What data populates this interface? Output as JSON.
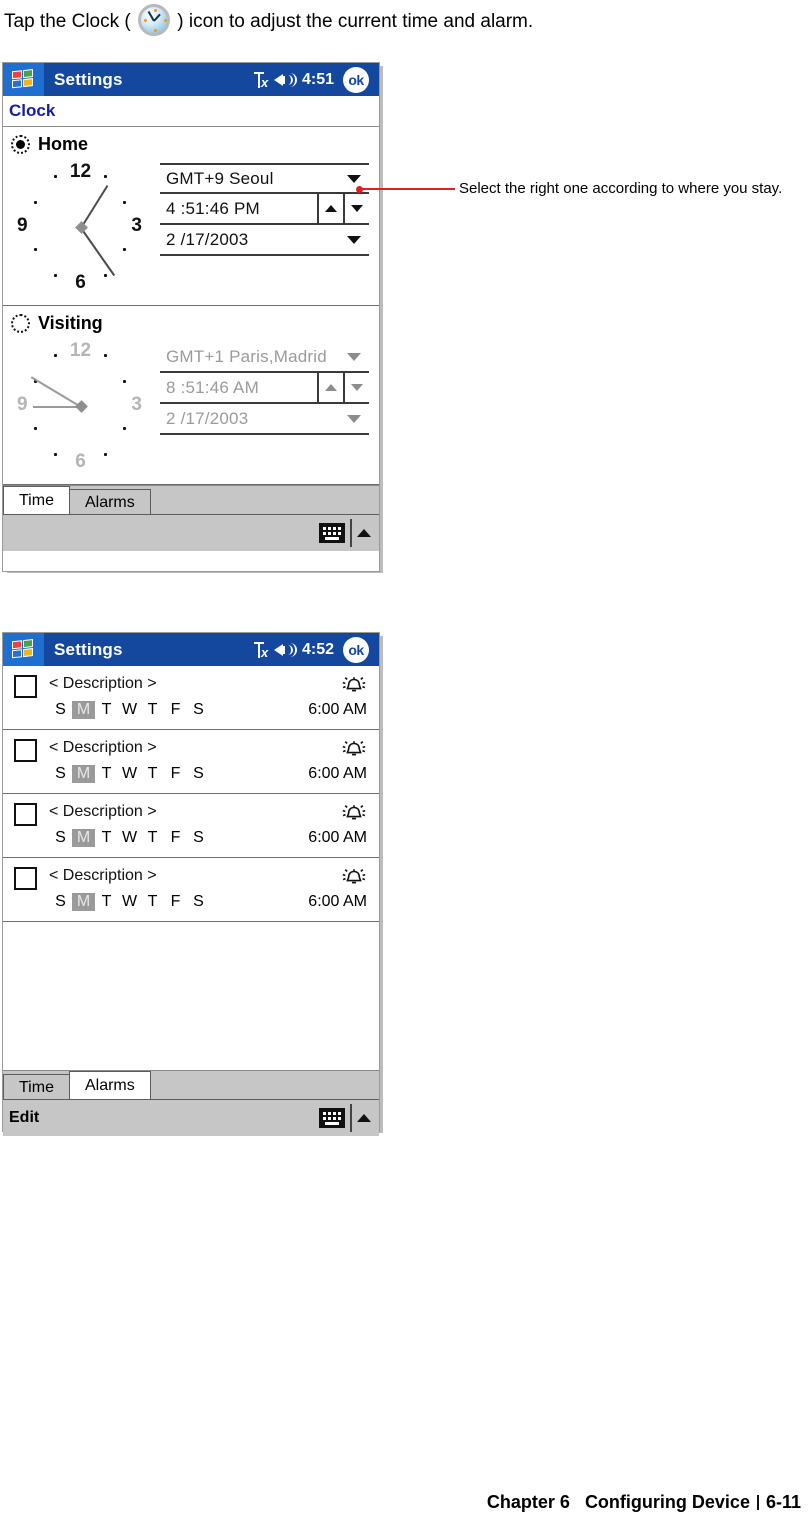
{
  "intro": {
    "before": "Tap the Clock ( ",
    "after": " ) icon to adjust the current time and alarm.",
    "icon": "clock-icon"
  },
  "screen1": {
    "titlebar": {
      "app": "Settings",
      "signal_icon": "signal-off-icon",
      "volume_icon": "volume-icon",
      "clock": "4:51",
      "ok": "ok"
    },
    "page_title": "Clock",
    "home": {
      "label": "Home",
      "selected": true,
      "timezone": "GMT+9 Seoul",
      "time": "4 :51:46 PM",
      "date": "2 /17/2003",
      "clock_numerals": [
        "12",
        "3",
        "6",
        "9"
      ]
    },
    "visiting": {
      "label": "Visiting",
      "selected": false,
      "timezone": "GMT+1 Paris,Madrid",
      "time": "8 :51:46 AM",
      "date": "2 /17/2003",
      "clock_numerals": [
        "12",
        "3",
        "6",
        "9"
      ]
    },
    "tabs": [
      {
        "label": "Time",
        "active": true
      },
      {
        "label": "Alarms",
        "active": false
      }
    ],
    "command_bar": {
      "label": "",
      "keyboard_icon": "keyboard-icon",
      "expand_icon": "caret-up-icon"
    }
  },
  "annotation": {
    "text": "Select the right one according to where you stay.",
    "color": "#e02020"
  },
  "screen2": {
    "titlebar": {
      "app": "Settings",
      "signal_icon": "signal-off-icon",
      "volume_icon": "volume-icon",
      "clock": "4:52",
      "ok": "ok"
    },
    "day_letters": [
      "S",
      "M",
      "T",
      "W",
      "T",
      "F",
      "S"
    ],
    "selected_day_index": 1,
    "alarms": [
      {
        "checked": false,
        "description": "< Description >",
        "time": "6:00 AM",
        "bell_icon": "alarm-bell-icon"
      },
      {
        "checked": false,
        "description": "< Description >",
        "time": "6:00 AM",
        "bell_icon": "alarm-bell-icon"
      },
      {
        "checked": false,
        "description": "< Description >",
        "time": "6:00 AM",
        "bell_icon": "alarm-bell-icon"
      },
      {
        "checked": false,
        "description": "< Description >",
        "time": "6:00 AM",
        "bell_icon": "alarm-bell-icon"
      }
    ],
    "tabs": [
      {
        "label": "Time",
        "active": false
      },
      {
        "label": "Alarms",
        "active": true
      }
    ],
    "command_bar": {
      "label": "Edit",
      "keyboard_icon": "keyboard-icon",
      "expand_icon": "caret-up-icon"
    }
  },
  "footer": {
    "chapter": "Chapter 6",
    "section": "Configuring Device",
    "page": "6-11"
  }
}
